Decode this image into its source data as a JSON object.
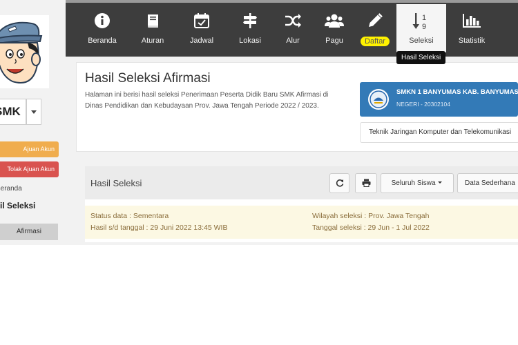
{
  "nav": {
    "items": [
      {
        "label": "Beranda"
      },
      {
        "label": "Aturan"
      },
      {
        "label": "Jadwal"
      },
      {
        "label": "Lokasi"
      },
      {
        "label": "Alur"
      },
      {
        "label": "Pagu"
      },
      {
        "label": "Daftar"
      },
      {
        "label": "Seleksi"
      },
      {
        "label": "Statistik"
      }
    ],
    "active": "Seleksi",
    "tooltip": "Hasil Seleksi"
  },
  "sidebar": {
    "school_select": "SMK",
    "btn_ajuan": "Ajuan Akun",
    "btn_tolak": "Tolak Ajuan Akun",
    "breadcrumb_home": "Beranda",
    "breadcrumb_current": "Hasil Seleksi",
    "menu_afirmasi": "Afirmasi"
  },
  "page": {
    "title": "Hasil Seleksi Afirmasi",
    "description": "Halaman ini berisi hasil seleksi Penerimaan Peserta Didik Baru SMK Afirmasi di Dinas Pendidikan dan Kebudayaan Prov. Jawa Tengah Periode 2022 / 2023."
  },
  "school": {
    "name": "SMKN 1 BANYUMAS KAB. BANYUMAS",
    "npsn": "NEGERI - 20302104",
    "program": "Teknik Jaringan Komputer dan Telekomunikasi"
  },
  "results": {
    "title": "Hasil Seleksi",
    "filter_label": "Seluruh Siswa",
    "view_label": "Data Sederhana",
    "status_data": "Status data : Sementara",
    "as_of": "Hasil s/d tanggal : 29 Juni 2022 13:45 WIB",
    "region": "Wilayah seleksi : Prov. Jawa Tengah",
    "selection_dates": "Tanggal seleksi : 29 Jun - 1 Jul 2022"
  },
  "colors": {
    "navbar": "#3d3d3d",
    "ajuan": "#f0ad4e",
    "tolak": "#d9534f",
    "school_card": "#337ab7",
    "status_bg": "#fcf8e3"
  }
}
